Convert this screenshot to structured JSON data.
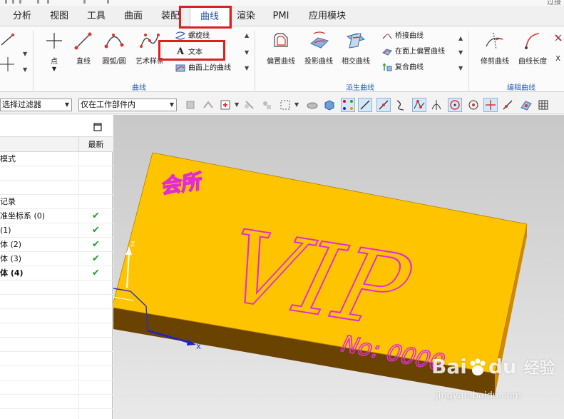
{
  "titlebar": {
    "right_text": "过接"
  },
  "menu": {
    "tabs": [
      {
        "label": "分析"
      },
      {
        "label": "视图"
      },
      {
        "label": "工具"
      },
      {
        "label": "曲面"
      },
      {
        "label": "装配"
      },
      {
        "label": "曲线",
        "active": true
      },
      {
        "label": "渲染"
      },
      {
        "label": "PMI"
      },
      {
        "label": "应用模块"
      }
    ]
  },
  "ribbon": {
    "curve_group": {
      "label": "曲线",
      "point": "点",
      "line": "直线",
      "arc": "圆弧/圆",
      "studio_spline": "艺术样条",
      "helix": "螺旋线",
      "text": "文本",
      "curve_on_surface": "曲面上的曲线"
    },
    "derived_group": {
      "label": "派生曲线",
      "offset_curve": "偏置曲线",
      "project_curve": "投影曲线",
      "intersection_curve": "相交曲线",
      "bridge_curve": "桥接曲线",
      "offset_on_face": "在面上偏置曲线",
      "composite_curve": "复合曲线"
    },
    "edit_group": {
      "label": "编辑曲线",
      "trim_curve": "修剪曲线",
      "curve_length": "曲线长度",
      "more": "X"
    }
  },
  "filterbar": {
    "selection_filter": "选择过滤器",
    "scope": "仅在工作部件内"
  },
  "navigator": {
    "col_latest": "最新",
    "rows": [
      {
        "name": "模式",
        "check": ""
      },
      {
        "name": "",
        "check": ""
      },
      {
        "name": "",
        "check": ""
      },
      {
        "name": "记录",
        "check": ""
      },
      {
        "name": "准坐标系 (0)",
        "check": "✔"
      },
      {
        "name": "(1)",
        "check": "✔"
      },
      {
        "name": "体 (2)",
        "check": "✔"
      },
      {
        "name": "体 (3)",
        "check": "✔"
      },
      {
        "name": "体 (4)",
        "check": "✔",
        "bold": true
      },
      {
        "name": "",
        "check": ""
      },
      {
        "name": "",
        "check": ""
      },
      {
        "name": "",
        "check": ""
      },
      {
        "name": "",
        "check": ""
      },
      {
        "name": "",
        "check": ""
      },
      {
        "name": "",
        "check": ""
      },
      {
        "name": "",
        "check": ""
      },
      {
        "name": "",
        "check": ""
      },
      {
        "name": "",
        "check": ""
      },
      {
        "name": "",
        "check": ""
      }
    ]
  },
  "model": {
    "small_text": "会所",
    "big_text": "VIP",
    "number_text": "No: 0000",
    "axis_x": "X",
    "axis_z": "Z"
  },
  "watermark": {
    "brand": "Bai",
    "brand2": "du",
    "suffix": "经验",
    "url": "jingyan.baidu.com"
  },
  "colors": {
    "accent_tab": "#1a4fa0",
    "plate_top": "#ffc400",
    "plate_side": "#d08a00",
    "text_outline": "#e32bd8",
    "highlight_box": "#e21d1d"
  }
}
